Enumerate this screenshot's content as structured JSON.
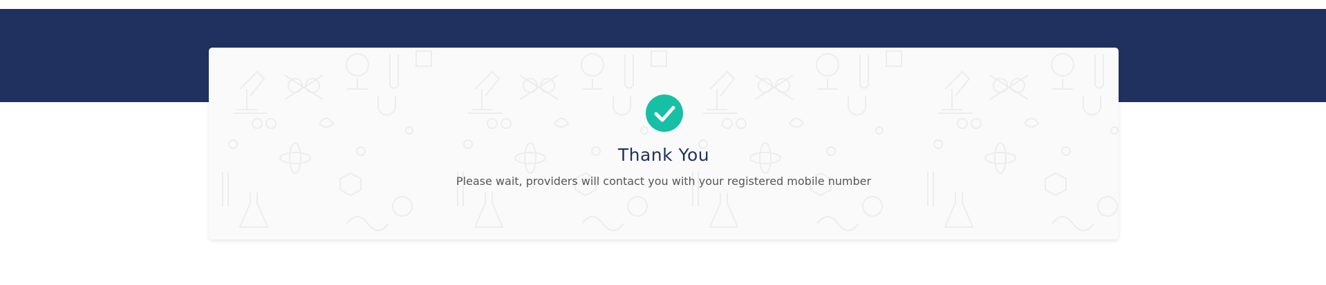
{
  "colors": {
    "header_band": "#20315f",
    "card_background": "#fafafa",
    "check_circle": "#17bfa4",
    "title_text": "#20315f",
    "subtitle_text": "#555555"
  },
  "confirmation": {
    "icon": "check-circle-icon",
    "title": "Thank You",
    "message": "Please wait, providers will contact you with your registered mobile number"
  }
}
